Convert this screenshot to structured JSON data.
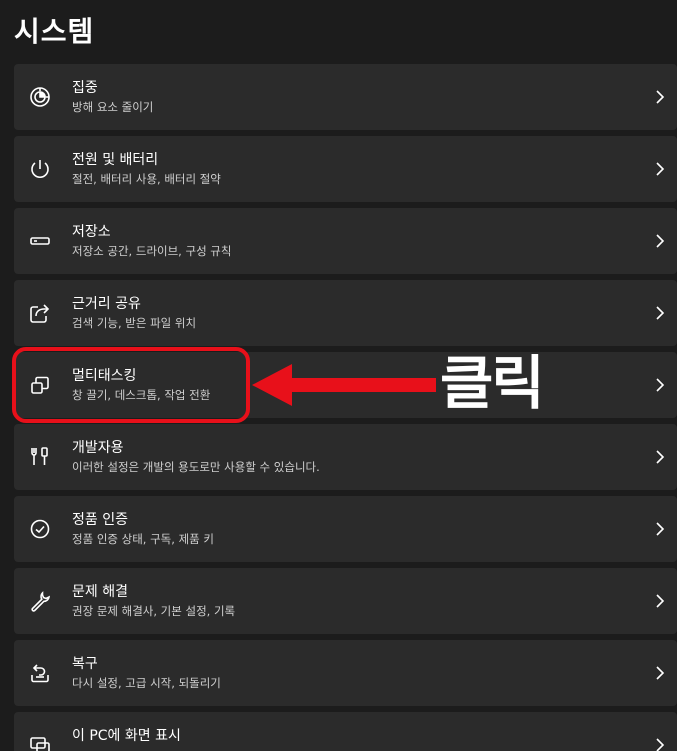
{
  "page": {
    "title": "시스템"
  },
  "items": [
    {
      "title": "집중",
      "subtitle": "방해 요소 줄이기",
      "icon": "focus-icon"
    },
    {
      "title": "전원 및 배터리",
      "subtitle": "절전, 배터리 사용, 배터리 절약",
      "icon": "power-icon"
    },
    {
      "title": "저장소",
      "subtitle": "저장소 공간, 드라이브, 구성 규칙",
      "icon": "storage-icon"
    },
    {
      "title": "근거리 공유",
      "subtitle": "검색 기능, 받은 파일 위치",
      "icon": "share-icon"
    },
    {
      "title": "멀티태스킹",
      "subtitle": "창 끌기, 데스크톱, 작업 전환",
      "icon": "multitasking-icon"
    },
    {
      "title": "개발자용",
      "subtitle": "이러한 설정은 개발의 용도로만 사용할 수 있습니다.",
      "icon": "developer-icon"
    },
    {
      "title": "정품 인증",
      "subtitle": "정품 인증 상태, 구독, 제품 키",
      "icon": "activation-icon"
    },
    {
      "title": "문제 해결",
      "subtitle": "권장 문제 해결사, 기본 설정, 기록",
      "icon": "wrench-icon"
    },
    {
      "title": "복구",
      "subtitle": "다시 설정, 고급 시작, 되돌리기",
      "icon": "recovery-icon"
    },
    {
      "title": "이 PC에 화면 표시",
      "subtitle": "",
      "icon": "project-icon"
    }
  ],
  "annotation": {
    "label": "클릭",
    "color": "#e8101a"
  },
  "colors": {
    "background": "#1c1c1c",
    "card": "#2b2b2b",
    "text": "#ffffff",
    "subtext": "#cfcfcf",
    "highlight": "#e8101a"
  }
}
